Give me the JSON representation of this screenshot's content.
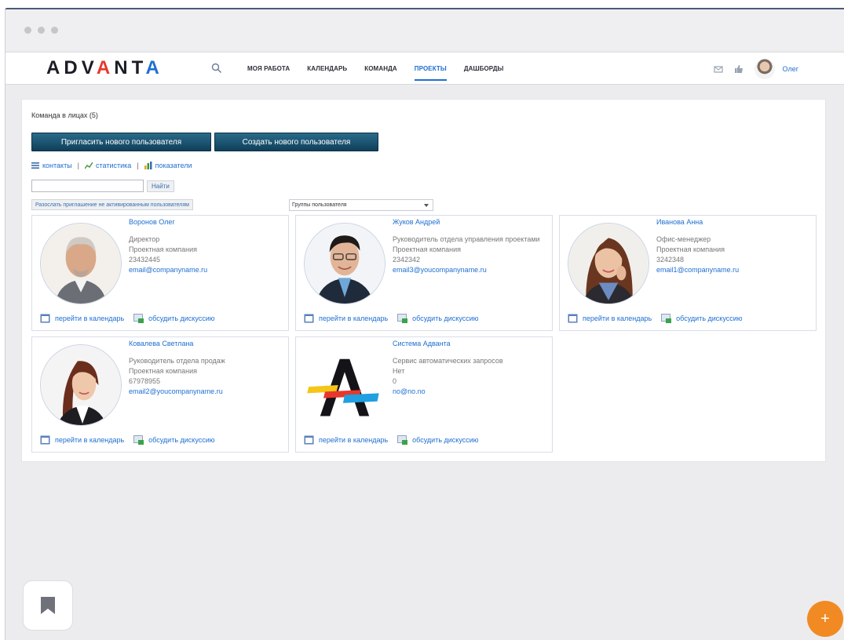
{
  "nav": {
    "logo": "ADVANTA",
    "links": [
      "МОЯ РАБОТА",
      "КАЛЕНДАРЬ",
      "КОМАНДА",
      "ПРОЕКТЫ",
      "ДАШБОРДЫ"
    ],
    "active_link": "ПРОЕКТЫ",
    "user_name": "Олег"
  },
  "page": {
    "team_title": "Команда в лицах (5)",
    "invite_button": "Пригласить нового пользователя",
    "create_button": "Создать нового пользователя",
    "view_links": {
      "contacts": "контакты",
      "stats": "статистика",
      "metrics": "показатели"
    },
    "search_value": "",
    "find_button": "Найти",
    "resend_button": "Разослать приглашение не активированным пользователям",
    "group_select": "Группы пользователя"
  },
  "card_actions": {
    "calendar": "перейти в календарь",
    "discuss": "обсудить дискуссию"
  },
  "users": [
    {
      "name": "Воронов Олег",
      "lines": [
        "Директор",
        "Проектная компания",
        "23432445"
      ],
      "email": "email@companyname.ru"
    },
    {
      "name": "Жуков Андрей",
      "lines": [
        "Руководитель отдела управления проектами",
        "Проектная компания",
        "2342342"
      ],
      "email": "email3@youcompanyname.ru"
    },
    {
      "name": "Иванова Анна",
      "lines": [
        "Офис-менеджер",
        "Проектная компания",
        "3242348"
      ],
      "email": "email1@companyname.ru"
    },
    {
      "name": "Ковалева Светлана",
      "lines": [
        "Руководитель отдела продаж",
        "Проектная компания",
        "67978955"
      ],
      "email": "email2@youcompanyname.ru"
    },
    {
      "name": "Система Адванта",
      "lines": [
        "Сервис автоматических запросов",
        "Нет",
        "0"
      ],
      "email": "no@no.no"
    }
  ],
  "colors": {
    "accent": "#1f6fd1",
    "button_dark": "#0f3f5a",
    "fab": "#f28a23"
  },
  "icons": {
    "search": "search-icon",
    "mail": "mail-icon",
    "like": "like-icon",
    "calendar": "calendar-icon",
    "discuss": "discussion-icon",
    "bookmark": "bookmark-icon",
    "add": "plus-icon"
  },
  "fab_label": "+"
}
